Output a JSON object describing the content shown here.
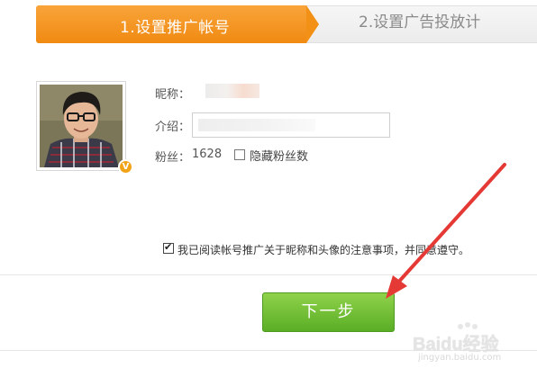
{
  "steps": [
    {
      "label": "1.设置推广帐号",
      "active": true
    },
    {
      "label": "2.设置广告投放计",
      "active": false
    }
  ],
  "profile": {
    "nickname_label": "昵称：",
    "intro_label": "介绍：",
    "fans_label": "粉丝：",
    "fans_count": "1628",
    "hide_fans_label": "隐藏粉丝数",
    "hide_fans_checked": false,
    "badge": "V"
  },
  "agreement": {
    "label": "我已阅读帐号推广关于昵称和头像的注意事项，并同意遵守。",
    "checked": true
  },
  "actions": {
    "next_label": "下一步"
  },
  "watermark": {
    "brand": "Baidu经验",
    "url": "jingyan.baidu.com"
  },
  "colors": {
    "active_step": "#f29115",
    "next_button": "#6bbf32",
    "annotation_arrow": "#e53935",
    "badge": "#f2a418"
  },
  "icons": [
    "vip-badge-icon",
    "checkbox-icon",
    "annotation-arrow-icon",
    "baidu-paw-icon"
  ]
}
